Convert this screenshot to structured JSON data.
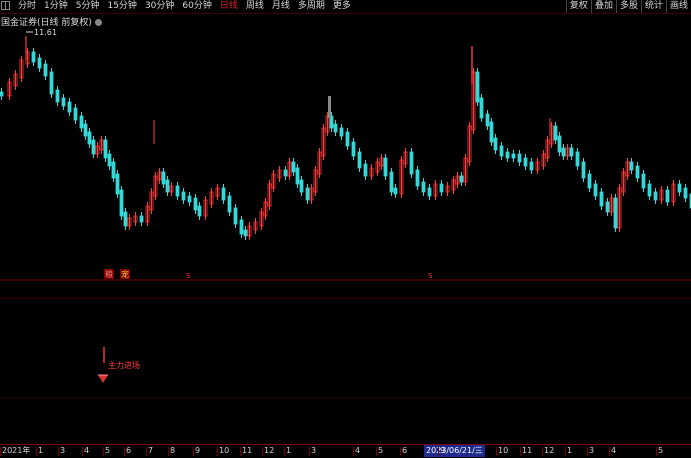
{
  "toolbar": {
    "tabs": [
      {
        "label": "分时",
        "active": false
      },
      {
        "label": "1分钟",
        "active": false
      },
      {
        "label": "5分钟",
        "active": false
      },
      {
        "label": "15分钟",
        "active": false
      },
      {
        "label": "30分钟",
        "active": false
      },
      {
        "label": "60分钟",
        "active": false
      },
      {
        "label": "日线",
        "active": true
      },
      {
        "label": "周线",
        "active": false
      },
      {
        "label": "月线",
        "active": false
      },
      {
        "label": "多周期",
        "active": false
      },
      {
        "label": "更多",
        "active": false
      }
    ],
    "right_buttons": [
      "复权",
      "叠加",
      "多股",
      "统计",
      "画线"
    ]
  },
  "chart_title": "国金证券(日线 前复权)",
  "max_label": "11.61",
  "signal_labels": {
    "tag1": "粮",
    "tag2": "宠",
    "marker_s1": "S",
    "marker_s2": "S",
    "main_force": "主力进场"
  },
  "date_axis": {
    "labels": [
      "2021年",
      "1",
      "3",
      "4",
      "5",
      "6",
      "7",
      "8",
      "9",
      "10",
      "11",
      "12",
      "1",
      "3",
      "4",
      "5",
      "6",
      "2023/06/21/三",
      "9",
      "10",
      "11",
      "12",
      "1",
      "3",
      "4",
      "5"
    ],
    "highlight": "2023/06/21/三"
  },
  "colors": {
    "background": "#000000",
    "up": "#ff3b3b",
    "down": "#36d7d7",
    "frame": "#7a0000",
    "accent": "#e02020",
    "highlight": "#1e2a8c"
  },
  "chart_data": {
    "type": "candlestick",
    "series_description": "daily price candles (close path, red=up cyan=down)",
    "max_price": 11.61,
    "x": [
      "2021年",
      "1",
      "3",
      "4",
      "5",
      "6",
      "7",
      "8",
      "9",
      "10",
      "11",
      "12",
      "1",
      "3",
      "4",
      "5",
      "6",
      "2023/06/21/三",
      "9",
      "10",
      "11",
      "12",
      "1",
      "3",
      "4",
      "5"
    ]
  }
}
